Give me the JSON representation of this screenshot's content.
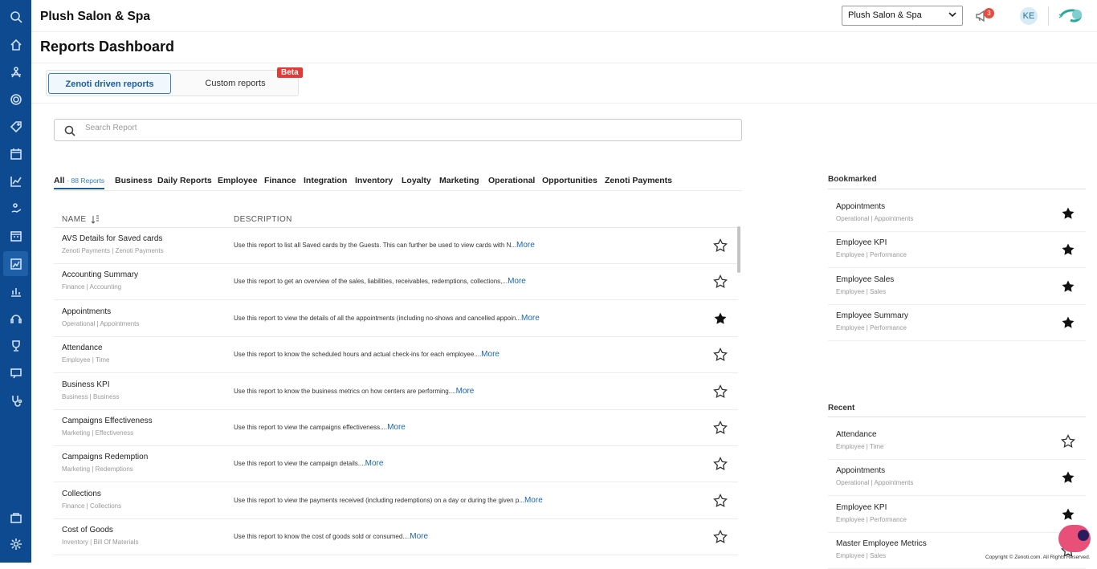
{
  "app": {
    "brand": "Plush Salon & Spa"
  },
  "header": {
    "location_select": "Plush Salon & Spa",
    "notification_count": "3",
    "avatar_initials": "KE"
  },
  "page": {
    "title": "Reports Dashboard"
  },
  "tabs": [
    {
      "label": "Zenoti driven reports",
      "active": true
    },
    {
      "label": "Custom reports",
      "active": false,
      "badge": "Beta"
    }
  ],
  "search": {
    "placeholder": "Search Report",
    "value": ""
  },
  "categories": {
    "all_label": "All",
    "all_count": "· 88 Reports",
    "items": [
      "Business",
      "Daily Reports",
      "Employee",
      "Finance",
      "Integration",
      "Inventory",
      "Loyalty",
      "Marketing",
      "Operational",
      "Opportunities",
      "Zenoti Payments"
    ]
  },
  "table": {
    "col_name": "NAME",
    "col_description": "DESCRIPTION",
    "rows": [
      {
        "name": "AVS Details for Saved cards",
        "sub": "Zenoti Payments | Zenoti Payments",
        "desc": "Use this report to list all Saved cards by the Guests. This can further be used to view cards with N...",
        "more": "More",
        "starred": false
      },
      {
        "name": "Accounting Summary",
        "sub": "Finance | Accounting",
        "desc": "Use this report to get an overview of the sales, liabilities, receivables, redemptions, collections,...",
        "more": "More",
        "starred": false
      },
      {
        "name": "Appointments",
        "sub": "Operational | Appointments",
        "desc": "Use this report to view the details of all the appointments (including no-shows and cancelled appoin...",
        "more": "More",
        "starred": true
      },
      {
        "name": "Attendance",
        "sub": "Employee | Time",
        "desc": "Use this report to know the scheduled hours and actual check-ins for each employee....",
        "more": "More",
        "starred": false
      },
      {
        "name": "Business KPI",
        "sub": "Business | Business",
        "desc": "Use this report to know the business metrics on how centers are performing....",
        "more": "More",
        "starred": false
      },
      {
        "name": "Campaigns Effectiveness",
        "sub": "Marketing | Effectiveness",
        "desc": "Use this report to view the campaigns effectiveness....",
        "more": "More",
        "starred": false
      },
      {
        "name": "Campaigns Redemption",
        "sub": "Marketing | Redemptions",
        "desc": "Use this report to view the campaign details....",
        "more": "More",
        "starred": false
      },
      {
        "name": "Collections",
        "sub": "Finance | Collections",
        "desc": "Use this report to view the payments received (including redemptions) on a day or during the given p...",
        "more": "More",
        "starred": false
      },
      {
        "name": "Cost of Goods",
        "sub": "Inventory | Bill Of Materials",
        "desc": "Use this report to know the cost of goods sold or consumed....",
        "more": "More",
        "starred": false
      }
    ]
  },
  "bookmarked": {
    "title": "Bookmarked",
    "items": [
      {
        "name": "Appointments",
        "sub": "Operational | Appointments",
        "starred": true
      },
      {
        "name": "Employee KPI",
        "sub": "Employee | Performance",
        "starred": true
      },
      {
        "name": "Employee Sales",
        "sub": "Employee | Sales",
        "starred": true
      },
      {
        "name": "Employee Summary",
        "sub": "Employee | Performance",
        "starred": true
      }
    ]
  },
  "recent": {
    "title": "Recent",
    "items": [
      {
        "name": "Attendance",
        "sub": "Employee | Time",
        "starred": false
      },
      {
        "name": "Appointments",
        "sub": "Operational | Appointments",
        "starred": true
      },
      {
        "name": "Employee KPI",
        "sub": "Employee | Performance",
        "starred": true
      },
      {
        "name": "Master Employee Metrics",
        "sub": "Employee | Sales",
        "starred": false
      }
    ]
  },
  "footer": {
    "copyright": "Copyright © Zenoti.com. All Rights Reserved."
  },
  "colors": {
    "nav_bg": "#0e4a8f",
    "accent": "#1b5e99",
    "link": "#1b66b0",
    "beta": "#e53935"
  }
}
